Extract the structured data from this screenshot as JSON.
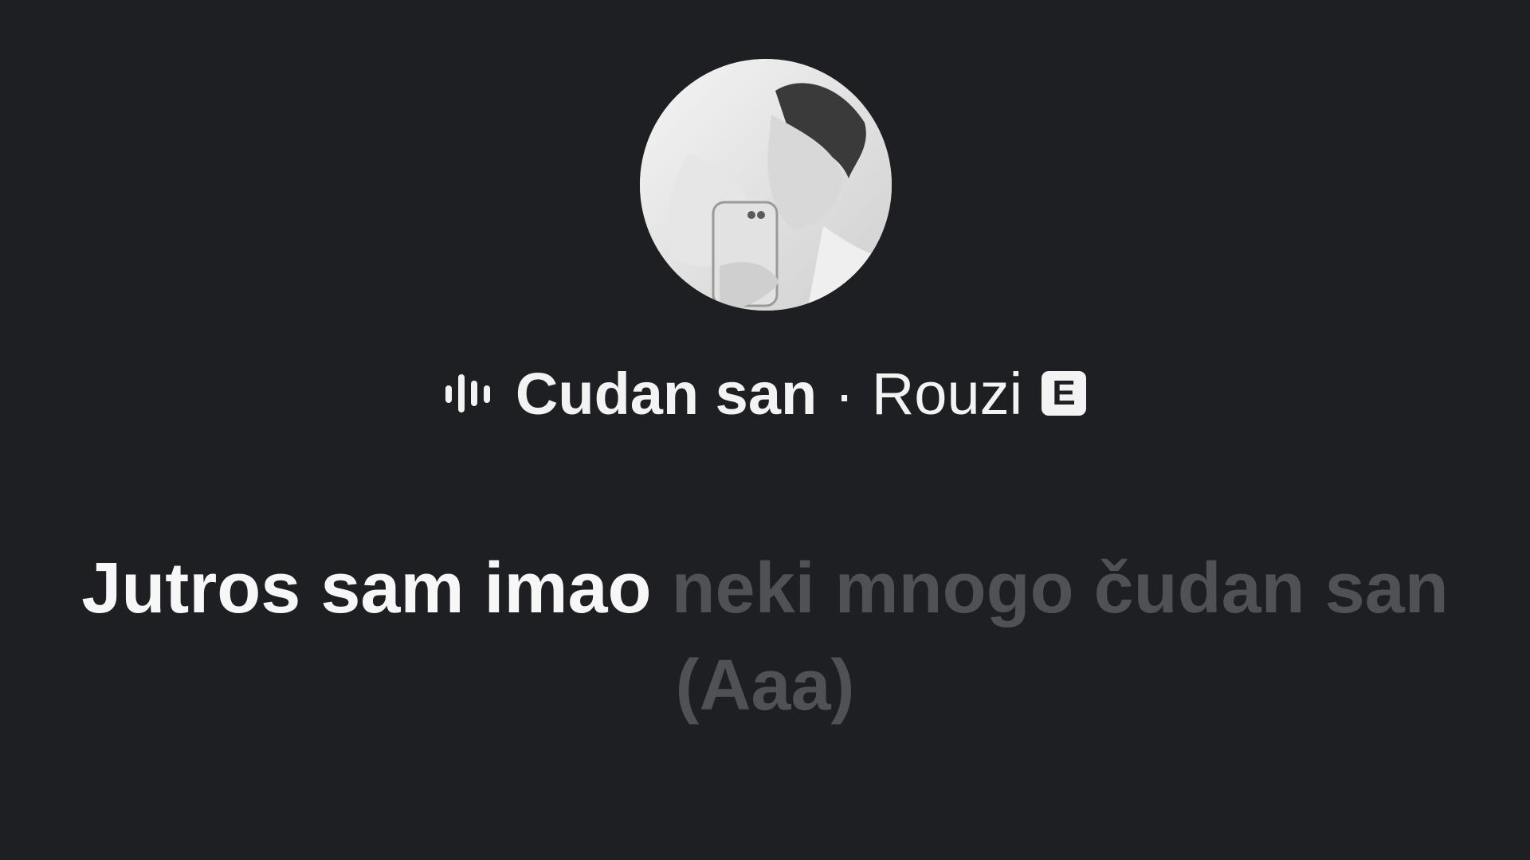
{
  "now_playing": {
    "song_title": "Cudan san",
    "separator": "·",
    "artist": "Rouzi",
    "explicit_badge": "E",
    "audio_icon": "audio-wave-icon"
  },
  "lyrics": {
    "sung": "Jutros sam imao",
    "upcoming": "neki mnogo čudan san (Aaa)"
  },
  "colors": {
    "background": "#1e1f23",
    "text_primary": "#f7f7f7",
    "text_dim": "#505155"
  }
}
